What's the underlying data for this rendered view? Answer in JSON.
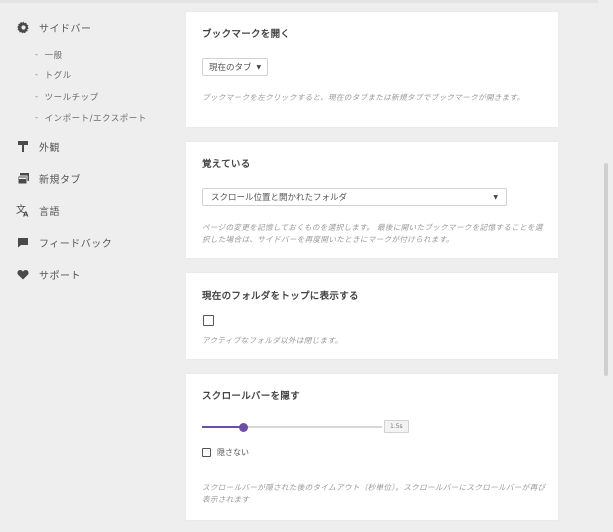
{
  "sidebar": {
    "sidebar_label": "サイドバー",
    "sub_items": [
      "一般",
      "トグル",
      "ツールチップ",
      "インポート/エクスポート"
    ],
    "appearance": "外観",
    "new_tab": "新規タブ",
    "language": "言語",
    "feedback": "フィードバック",
    "support": "サポート",
    "sub_dash": "-"
  },
  "bookmarks_card": {
    "title": "ブックマークを開く",
    "select_value": "現在のタブ",
    "description": "ブックマークを左クリックすると、現在のタブまたは新規タブでブックマークが開きます。"
  },
  "remember_card": {
    "title": "覚えている",
    "select_value": "スクロール位置と開かれたフォルダ",
    "description": "ページの変更を記憶しておくものを選択します。 最後に開いたブックマークを記憶することを選択した場合は、サイドバーを再度開いたときにマークが付けられます。"
  },
  "current_folder_card": {
    "title": "現在のフォルダをトップに表示する",
    "checked": false,
    "description": "アクティブなフォルダ以外は閉じます。"
  },
  "scrollbar_card": {
    "title": "スクロールバーを隠す",
    "slider_value_label": "1.5s",
    "slider_fraction": 0.23,
    "checkbox_label": "隠さない",
    "checked": false,
    "description": "スクロールバーが隠された後のタイムアウト（秒単位）。スクロールバーにスクロールバーが再び表示されます"
  },
  "icons": {
    "sidebar": "gear-icon",
    "appearance": "paint-roller-icon",
    "new_tab": "new-tab-icon",
    "language": "translate-icon",
    "feedback": "comment-icon",
    "support": "heart-icon",
    "dropdown": "caret-down-icon"
  },
  "colors": {
    "accent": "#6b4fa3",
    "background": "#eeeeee",
    "card": "#ffffff"
  }
}
